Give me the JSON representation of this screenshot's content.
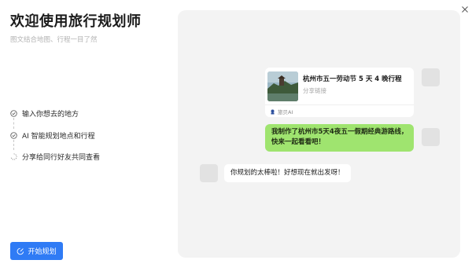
{
  "header": {
    "title": "欢迎使用旅行规划师",
    "subtitle": "图文结合地图、行程一目了然"
  },
  "steps": [
    {
      "label": "输入你想去的地方"
    },
    {
      "label": "AI 智能规划地点和行程"
    },
    {
      "label": "分享给同行好友共同查看"
    }
  ],
  "start_button": {
    "label": "开始规划"
  },
  "preview": {
    "card": {
      "title": "杭州市五一劳动节 5 天 4 晚行程",
      "subtitle": "分享链接",
      "footer": "旅贝AI"
    },
    "user_message": {
      "line1": "我制作了杭州市5天4夜五一假期经典游路线，",
      "line2": "快来一起看看吧！"
    },
    "reply_message": "你规划的太棒啦！好想现在就出发呀！"
  },
  "colors": {
    "accent": "#2f7bf5",
    "bubble_green": "#9fe46f",
    "panel_bg": "#f3f3f3"
  }
}
